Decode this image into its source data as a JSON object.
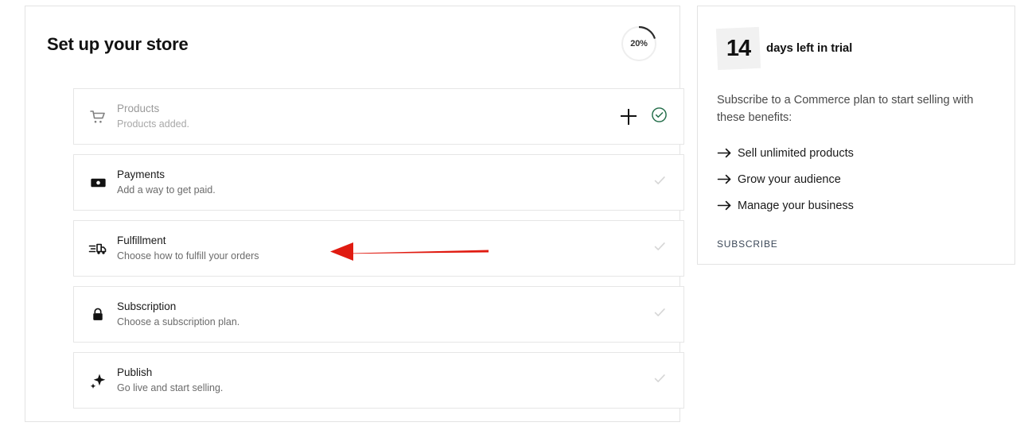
{
  "setup": {
    "title": "Set up your store",
    "progress": {
      "label": "20%",
      "percent": 20
    },
    "steps": [
      {
        "icon": "shopping-cart-icon",
        "title": "Products",
        "description": "Products added.",
        "status": "done",
        "has_add_button": true
      },
      {
        "icon": "banknote-icon",
        "title": "Payments",
        "description": "Add a way to get paid.",
        "status": "pending",
        "has_add_button": false
      },
      {
        "icon": "delivery-truck-icon",
        "title": "Fulfillment",
        "description": "Choose how to fulfill your orders",
        "status": "pending",
        "has_add_button": false
      },
      {
        "icon": "lock-icon",
        "title": "Subscription",
        "description": "Choose a subscription plan.",
        "status": "pending",
        "has_add_button": false
      },
      {
        "icon": "sparkle-icon",
        "title": "Publish",
        "description": "Go live and start selling.",
        "status": "pending",
        "has_add_button": false
      }
    ]
  },
  "trial": {
    "days": "14",
    "days_label": "days left in trial",
    "body": "Subscribe to a Commerce plan to start selling with these benefits:",
    "benefits": [
      "Sell unlimited products",
      "Grow your audience",
      "Manage your business"
    ],
    "subscribe_label": "SUBSCRIBE"
  },
  "colors": {
    "done_check": "#1f6b46",
    "pending_check": "#d6d6d6",
    "annotation_arrow": "#e01b11",
    "card_border": "#e3e3e3",
    "subscribe_link": "#3c4858"
  }
}
